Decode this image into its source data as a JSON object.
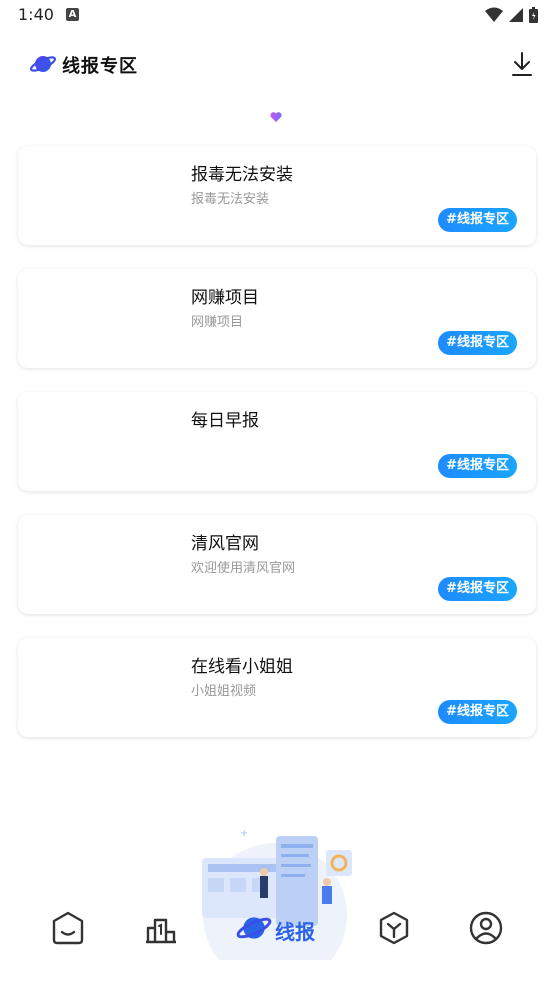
{
  "status_bar": {
    "time": "1:40",
    "notif_badge": "A"
  },
  "header": {
    "title": "线报专区",
    "logo_icon": "planet-icon",
    "action_icon": "download-icon"
  },
  "cards": [
    {
      "title": "报毒无法安装",
      "subtitle": "报毒无法安装",
      "tag": "#线报专区"
    },
    {
      "title": "网赚项目",
      "subtitle": "网赚项目",
      "tag": "#线报专区"
    },
    {
      "title": "每日早报",
      "subtitle": "",
      "tag": "#线报专区"
    },
    {
      "title": "清风官网",
      "subtitle": "欢迎使用清风官网",
      "tag": "#线报专区"
    },
    {
      "title": "在线看小姐姐",
      "subtitle": "小姐姐视频",
      "tag": "#线报专区"
    }
  ],
  "bottom_nav": {
    "items": [
      {
        "icon": "home-face-icon"
      },
      {
        "icon": "ranking-icon"
      },
      {
        "icon": "planet-icon",
        "label": "线报"
      },
      {
        "icon": "cube-icon"
      },
      {
        "icon": "profile-icon"
      }
    ]
  },
  "colors": {
    "accent": "#2b63e6",
    "tag_blue": "#1e8bff"
  }
}
